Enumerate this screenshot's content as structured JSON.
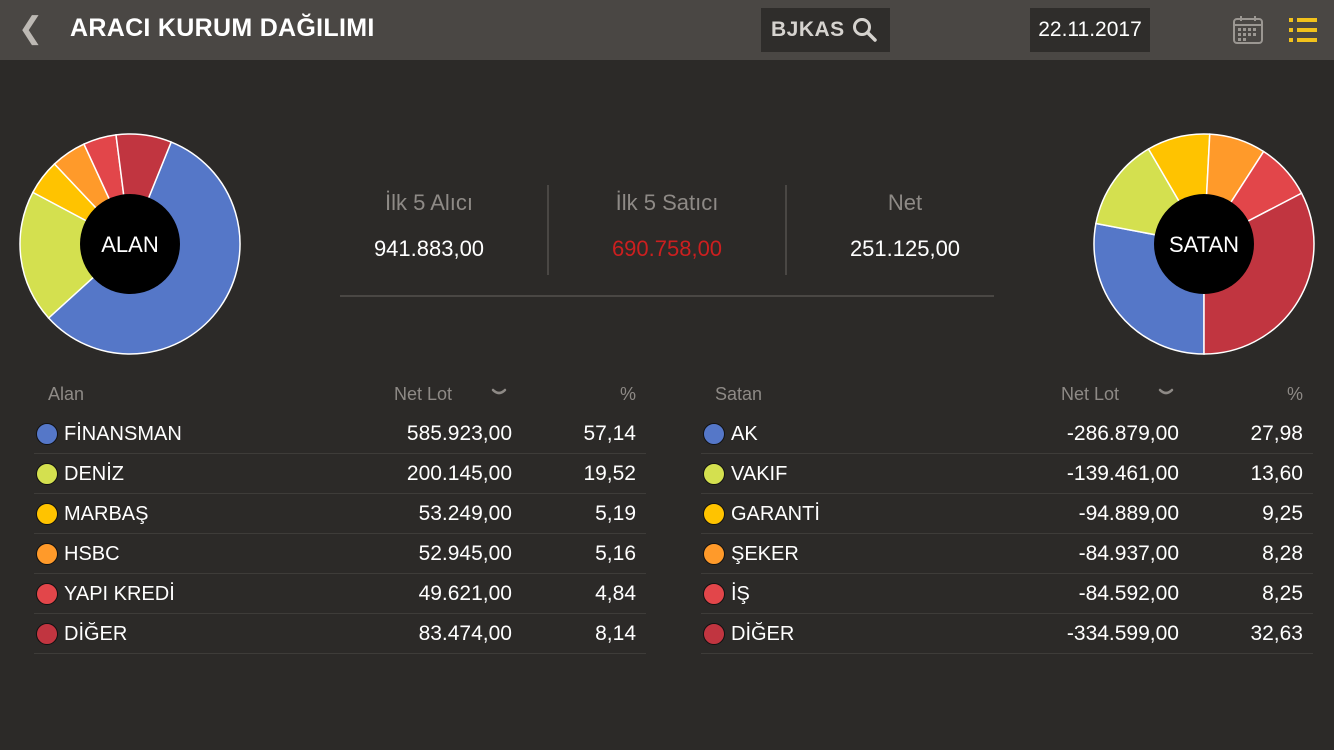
{
  "header": {
    "back_label": "❮",
    "title": "ARACI KURUM DAĞILIMI",
    "search_value": "BJKAS",
    "date": "22.11.2017"
  },
  "pies": {
    "left_label": "ALAN",
    "right_label": "SATAN"
  },
  "summary": {
    "buyers_label": "İlk 5 Alıcı",
    "buyers_value": "941.883,00",
    "sellers_label": "İlk 5 Satıcı",
    "sellers_value": "690.758,00",
    "net_label": "Net",
    "net_value": "251.125,00"
  },
  "colors": [
    "#5577c8",
    "#d4e04f",
    "#ffc300",
    "#ff9a2a",
    "#e2464a",
    "#c13540"
  ],
  "buyers": {
    "header_name": "Alan",
    "header_lot": "Net Lot",
    "header_pct": "%",
    "rows": [
      {
        "name": "FİNANSMAN",
        "lot": "585.923,00",
        "pct": "57,14",
        "share": 57.14
      },
      {
        "name": "DENİZ",
        "lot": "200.145,00",
        "pct": "19,52",
        "share": 19.52
      },
      {
        "name": "MARBAŞ",
        "lot": "53.249,00",
        "pct": "5,19",
        "share": 5.19
      },
      {
        "name": "HSBC",
        "lot": "52.945,00",
        "pct": "5,16",
        "share": 5.16
      },
      {
        "name": "YAPI KREDİ",
        "lot": "49.621,00",
        "pct": "4,84",
        "share": 4.84
      },
      {
        "name": "DİĞER",
        "lot": "83.474,00",
        "pct": "8,14",
        "share": 8.14
      }
    ]
  },
  "sellers": {
    "header_name": "Satan",
    "header_lot": "Net Lot",
    "header_pct": "%",
    "rows": [
      {
        "name": "AK",
        "lot": "-286.879,00",
        "pct": "27,98",
        "share": 27.98
      },
      {
        "name": "VAKIF",
        "lot": "-139.461,00",
        "pct": "13,60",
        "share": 13.6
      },
      {
        "name": "GARANTİ",
        "lot": "-94.889,00",
        "pct": "9,25",
        "share": 9.25
      },
      {
        "name": "ŞEKER",
        "lot": "-84.937,00",
        "pct": "8,28",
        "share": 8.28
      },
      {
        "name": "İŞ",
        "lot": "-84.592,00",
        "pct": "8,25",
        "share": 8.25
      },
      {
        "name": "DİĞER",
        "lot": "-334.599,00",
        "pct": "32,63",
        "share": 32.63
      }
    ]
  }
}
